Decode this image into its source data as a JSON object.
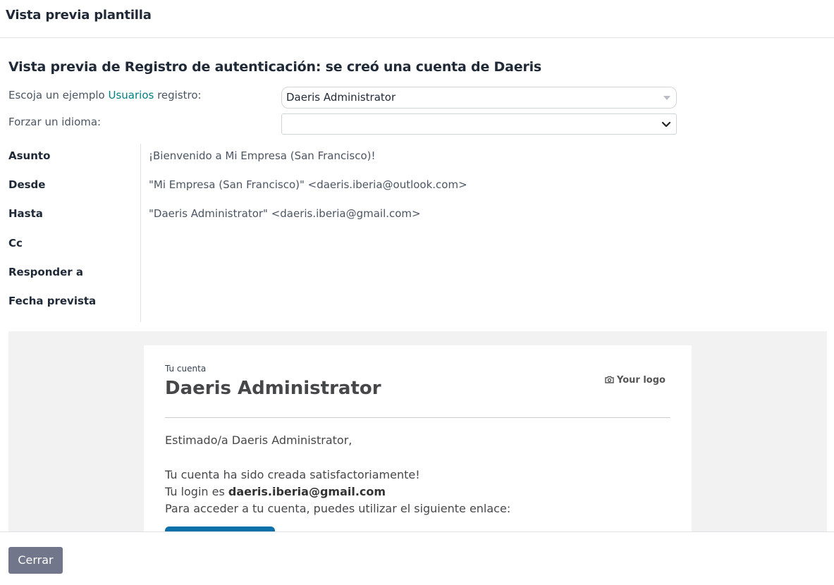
{
  "dialog": {
    "title": "Vista previa plantilla",
    "close_label": "Cerrar"
  },
  "preview": {
    "title": "Vista previa de Registro de autenticación: se creó una cuenta de Daeris",
    "example_prefix": "Escoja un ejemplo ",
    "example_link": "Usuarios",
    "example_suffix": " registro:",
    "example_value": "Daeris Administrator",
    "language_label": "Forzar un idioma:",
    "language_value": ""
  },
  "headers": {
    "subject_label": "Asunto",
    "subject_value": "¡Bienvenido a Mi Empresa (San Francisco)!",
    "from_label": "Desde",
    "from_value": "\"Mi Empresa (San Francisco)\" <daeris.iberia@outlook.com>",
    "to_label": "Hasta",
    "to_value": "\"Daeris Administrator\" <daeris.iberia@gmail.com>",
    "cc_label": "Cc",
    "cc_value": "",
    "reply_label": "Responder a",
    "reply_value": "",
    "date_label": "Fecha prevista",
    "date_value": ""
  },
  "email": {
    "eyebrow": "Tu cuenta",
    "name": "Daeris Administrator",
    "logo_text": "Your logo",
    "greeting": "Estimado/a Daeris Administrator,",
    "created": "Tu cuenta ha sido creada satisfactoriamente!",
    "login_prefix": "Tu login es ",
    "login_value": "daeris.iberia@gmail.com",
    "access": "Para acceder a tu cuenta, puedes utilizar el siguiente enlace:"
  },
  "colors": {
    "link": "#017e84",
    "close_button": "#71768a",
    "email_button": "#0b71a8"
  },
  "icons": {
    "select_caret": "caret-down-icon",
    "language_chevron": "chevron-down-icon",
    "logo_camera": "camera-icon"
  }
}
